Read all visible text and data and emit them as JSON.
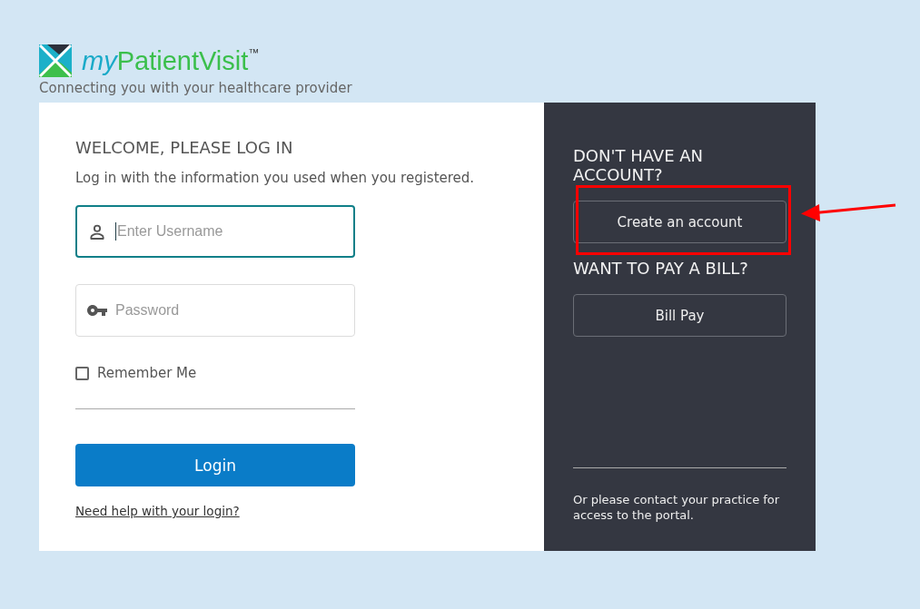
{
  "logo": {
    "prefix": "my",
    "name": "PatientVisit",
    "mark": "™",
    "tagline": "Connecting you with your healthcare provider"
  },
  "login": {
    "heading": "WELCOME, PLEASE LOG IN",
    "subtitle": "Log in with the information you used when you registered.",
    "fields": [
      {
        "kind": "username",
        "placeholder": "Enter Username",
        "focused": true
      },
      {
        "kind": "password",
        "placeholder": "Password",
        "focused": false
      }
    ],
    "remember_me": {
      "label": "Remember Me",
      "checked": false
    },
    "login_button": "Login",
    "help_link": "Need help with your login?"
  },
  "signup_panel": {
    "sections": [
      {
        "heading": "DON'T HAVE AN ACCOUNT?",
        "button": "Create an account",
        "highlighted": true
      },
      {
        "heading": "WANT TO PAY A BILL?",
        "button": "Bill Pay",
        "highlighted": false
      }
    ],
    "note": "Or please contact your practice for access to the portal."
  }
}
